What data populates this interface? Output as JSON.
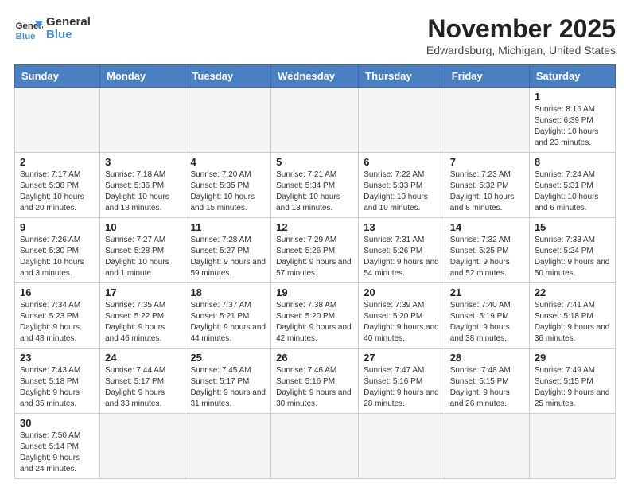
{
  "header": {
    "logo_general": "General",
    "logo_blue": "Blue",
    "month_title": "November 2025",
    "location": "Edwardsburg, Michigan, United States"
  },
  "weekdays": [
    "Sunday",
    "Monday",
    "Tuesday",
    "Wednesday",
    "Thursday",
    "Friday",
    "Saturday"
  ],
  "weeks": [
    [
      {
        "day": "",
        "info": "",
        "empty": true
      },
      {
        "day": "",
        "info": "",
        "empty": true
      },
      {
        "day": "",
        "info": "",
        "empty": true
      },
      {
        "day": "",
        "info": "",
        "empty": true
      },
      {
        "day": "",
        "info": "",
        "empty": true
      },
      {
        "day": "",
        "info": "",
        "empty": true
      },
      {
        "day": "1",
        "info": "Sunrise: 8:16 AM\nSunset: 6:39 PM\nDaylight: 10 hours and 23 minutes.",
        "empty": false
      }
    ],
    [
      {
        "day": "2",
        "info": "Sunrise: 7:17 AM\nSunset: 5:38 PM\nDaylight: 10 hours and 20 minutes.",
        "empty": false
      },
      {
        "day": "3",
        "info": "Sunrise: 7:18 AM\nSunset: 5:36 PM\nDaylight: 10 hours and 18 minutes.",
        "empty": false
      },
      {
        "day": "4",
        "info": "Sunrise: 7:20 AM\nSunset: 5:35 PM\nDaylight: 10 hours and 15 minutes.",
        "empty": false
      },
      {
        "day": "5",
        "info": "Sunrise: 7:21 AM\nSunset: 5:34 PM\nDaylight: 10 hours and 13 minutes.",
        "empty": false
      },
      {
        "day": "6",
        "info": "Sunrise: 7:22 AM\nSunset: 5:33 PM\nDaylight: 10 hours and 10 minutes.",
        "empty": false
      },
      {
        "day": "7",
        "info": "Sunrise: 7:23 AM\nSunset: 5:32 PM\nDaylight: 10 hours and 8 minutes.",
        "empty": false
      },
      {
        "day": "8",
        "info": "Sunrise: 7:24 AM\nSunset: 5:31 PM\nDaylight: 10 hours and 6 minutes.",
        "empty": false
      }
    ],
    [
      {
        "day": "9",
        "info": "Sunrise: 7:26 AM\nSunset: 5:30 PM\nDaylight: 10 hours and 3 minutes.",
        "empty": false
      },
      {
        "day": "10",
        "info": "Sunrise: 7:27 AM\nSunset: 5:28 PM\nDaylight: 10 hours and 1 minute.",
        "empty": false
      },
      {
        "day": "11",
        "info": "Sunrise: 7:28 AM\nSunset: 5:27 PM\nDaylight: 9 hours and 59 minutes.",
        "empty": false
      },
      {
        "day": "12",
        "info": "Sunrise: 7:29 AM\nSunset: 5:26 PM\nDaylight: 9 hours and 57 minutes.",
        "empty": false
      },
      {
        "day": "13",
        "info": "Sunrise: 7:31 AM\nSunset: 5:26 PM\nDaylight: 9 hours and 54 minutes.",
        "empty": false
      },
      {
        "day": "14",
        "info": "Sunrise: 7:32 AM\nSunset: 5:25 PM\nDaylight: 9 hours and 52 minutes.",
        "empty": false
      },
      {
        "day": "15",
        "info": "Sunrise: 7:33 AM\nSunset: 5:24 PM\nDaylight: 9 hours and 50 minutes.",
        "empty": false
      }
    ],
    [
      {
        "day": "16",
        "info": "Sunrise: 7:34 AM\nSunset: 5:23 PM\nDaylight: 9 hours and 48 minutes.",
        "empty": false
      },
      {
        "day": "17",
        "info": "Sunrise: 7:35 AM\nSunset: 5:22 PM\nDaylight: 9 hours and 46 minutes.",
        "empty": false
      },
      {
        "day": "18",
        "info": "Sunrise: 7:37 AM\nSunset: 5:21 PM\nDaylight: 9 hours and 44 minutes.",
        "empty": false
      },
      {
        "day": "19",
        "info": "Sunrise: 7:38 AM\nSunset: 5:20 PM\nDaylight: 9 hours and 42 minutes.",
        "empty": false
      },
      {
        "day": "20",
        "info": "Sunrise: 7:39 AM\nSunset: 5:20 PM\nDaylight: 9 hours and 40 minutes.",
        "empty": false
      },
      {
        "day": "21",
        "info": "Sunrise: 7:40 AM\nSunset: 5:19 PM\nDaylight: 9 hours and 38 minutes.",
        "empty": false
      },
      {
        "day": "22",
        "info": "Sunrise: 7:41 AM\nSunset: 5:18 PM\nDaylight: 9 hours and 36 minutes.",
        "empty": false
      }
    ],
    [
      {
        "day": "23",
        "info": "Sunrise: 7:43 AM\nSunset: 5:18 PM\nDaylight: 9 hours and 35 minutes.",
        "empty": false
      },
      {
        "day": "24",
        "info": "Sunrise: 7:44 AM\nSunset: 5:17 PM\nDaylight: 9 hours and 33 minutes.",
        "empty": false
      },
      {
        "day": "25",
        "info": "Sunrise: 7:45 AM\nSunset: 5:17 PM\nDaylight: 9 hours and 31 minutes.",
        "empty": false
      },
      {
        "day": "26",
        "info": "Sunrise: 7:46 AM\nSunset: 5:16 PM\nDaylight: 9 hours and 30 minutes.",
        "empty": false
      },
      {
        "day": "27",
        "info": "Sunrise: 7:47 AM\nSunset: 5:16 PM\nDaylight: 9 hours and 28 minutes.",
        "empty": false
      },
      {
        "day": "28",
        "info": "Sunrise: 7:48 AM\nSunset: 5:15 PM\nDaylight: 9 hours and 26 minutes.",
        "empty": false
      },
      {
        "day": "29",
        "info": "Sunrise: 7:49 AM\nSunset: 5:15 PM\nDaylight: 9 hours and 25 minutes.",
        "empty": false
      }
    ],
    [
      {
        "day": "30",
        "info": "Sunrise: 7:50 AM\nSunset: 5:14 PM\nDaylight: 9 hours and 24 minutes.",
        "empty": false
      },
      {
        "day": "",
        "info": "",
        "empty": true
      },
      {
        "day": "",
        "info": "",
        "empty": true
      },
      {
        "day": "",
        "info": "",
        "empty": true
      },
      {
        "day": "",
        "info": "",
        "empty": true
      },
      {
        "day": "",
        "info": "",
        "empty": true
      },
      {
        "day": "",
        "info": "",
        "empty": true
      }
    ]
  ]
}
